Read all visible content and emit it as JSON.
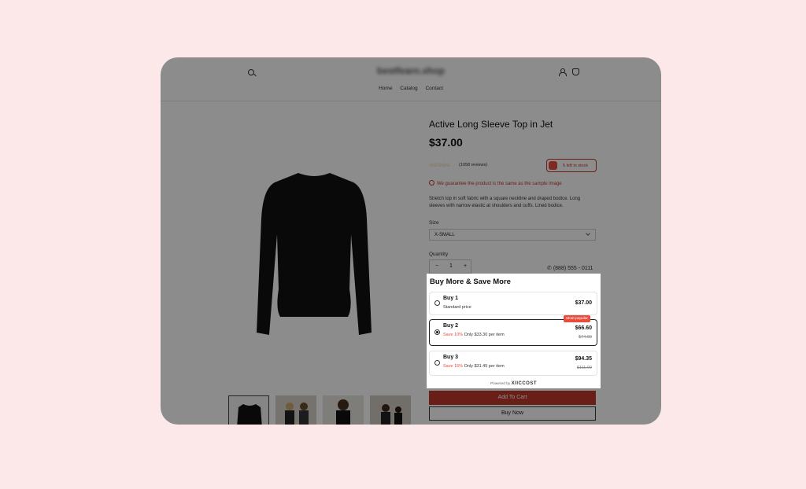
{
  "header": {
    "shop_name": "bestfearn.shop",
    "nav": [
      "Home",
      "Catalog",
      "Contact"
    ]
  },
  "product": {
    "title": "Active Long Sleeve Top in Jet",
    "price": "$37.00",
    "rating_stars": 5,
    "reviews": "(1058 reviews)",
    "stock": "5 left in stock",
    "guarantee": "We guarantee the product is the same as the sample image",
    "description": "Stretch top in soft fabric with a square neckline and draped bodice. Long sleeves with narrow elastic at shoulders and cuffs. Lined bodice.",
    "size_label": "Size",
    "size_value": "X-SMALL",
    "quantity_label": "Quantity",
    "quantity_minus": "−",
    "quantity_value": "1",
    "quantity_plus": "+",
    "phone": "(888) 555 - 0111",
    "add_to_cart": "Add To Cart",
    "buy_now": "Buy Now"
  },
  "bundle_widget": {
    "title": "Buy More & Save More",
    "options": [
      {
        "title": "Buy 1",
        "subtitle": "Standard price",
        "save": "",
        "price": "$37.00",
        "old_price": "",
        "selected": false,
        "badge": ""
      },
      {
        "title": "Buy 2",
        "subtitle": "Only $33.30 per item",
        "save": "Save 10%",
        "price": "$66.60",
        "old_price": "$74.00",
        "selected": true,
        "badge": "Most popular"
      },
      {
        "title": "Buy 3",
        "subtitle": "Only $31.45 per item",
        "save": "Save 15%",
        "price": "$94.35",
        "old_price": "$111.00",
        "selected": false,
        "badge": ""
      }
    ],
    "powered_by": "Powered by",
    "brand": "XIICCOST"
  },
  "colors": {
    "page_bg": "#fce8e8",
    "accent_red": "#e74c3c",
    "button_red": "#c0392b"
  }
}
